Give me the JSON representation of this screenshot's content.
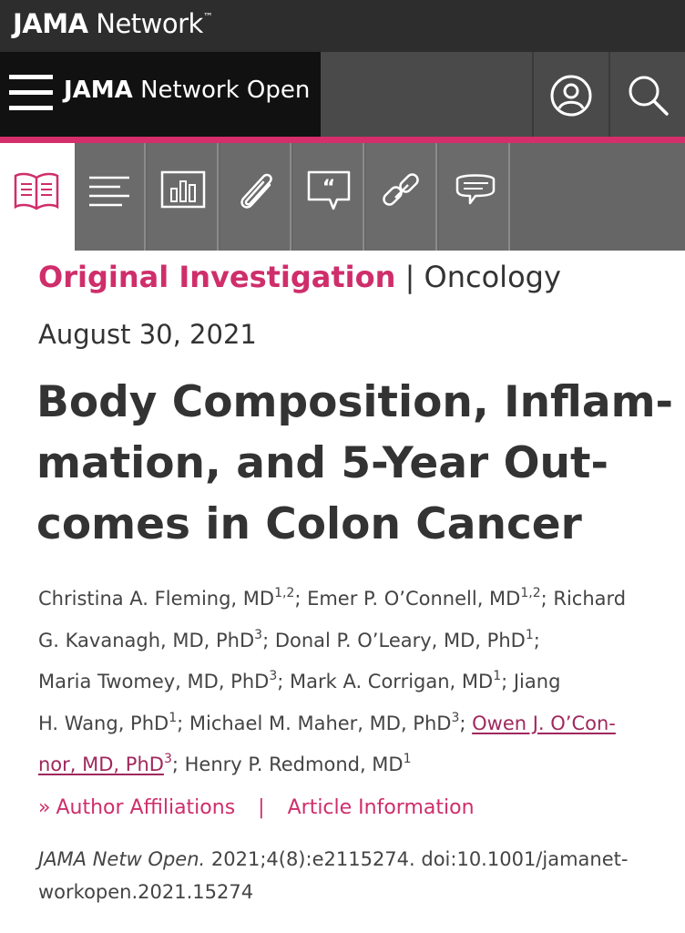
{
  "network": {
    "bold": "JAMA",
    "light": "Network",
    "tm": "™"
  },
  "journal": {
    "bold": "JAMA",
    "light": "Network Open"
  },
  "tabs": [
    {
      "icon": "article-book-icon",
      "active": true
    },
    {
      "icon": "outline-list-icon",
      "active": false
    },
    {
      "icon": "figures-chart-icon",
      "active": false
    },
    {
      "icon": "supplement-paperclip-icon",
      "active": false
    },
    {
      "icon": "comments-quote-icon",
      "active": false
    },
    {
      "icon": "related-link-icon",
      "active": false
    },
    {
      "icon": "discussion-chat-icon",
      "active": false
    }
  ],
  "article": {
    "type": "Original Investigation",
    "separator": "|",
    "subject": "Oncology",
    "date": "August 30, 2021",
    "title_lines": [
      "Body Composition, Inflam-",
      "mation, and 5-Year Out-",
      "comes in Colon Cancer"
    ],
    "authors": {
      "a1": "Christina A. Fleming, MD",
      "a1_sup": "1,2",
      "a2": "; Emer P. O’Connell, MD",
      "a2_sup": "1,2",
      "a3a": "; Richard",
      "a3b": "G. Kavanagh, MD, PhD",
      "a3_sup": "3",
      "a4": "; Donal P. O’Leary, MD, PhD",
      "a4_sup": "1",
      "a4_end": ";",
      "a5": "Maria Twomey, MD, PhD",
      "a5_sup": "3",
      "a6": "; Mark A. Corrigan, MD",
      "a6_sup": "1",
      "a7a": "; Jiang",
      "a7b": "H. Wang, PhD",
      "a7_sup": "1",
      "a8": "; Michael M. Maher, MD, PhD",
      "a8_sup": "3",
      "a8_end": "; ",
      "a9a": "Owen J. O’Con-",
      "a9b": "nor, MD, PhD",
      "a9_sup": "3",
      "a10": "; Henry P. Redmond, MD",
      "a10_sup": "1"
    },
    "links": {
      "chevron": "»",
      "affiliations": "Author Affiliations",
      "divider": "|",
      "info": "Article Information"
    },
    "citation": {
      "journal": "JAMA Netw Open.",
      "line1_rest": " 2021;4(8):e2115274. doi:10.1001/jamanet-",
      "line2": "workopen.2021.15274"
    }
  },
  "colors": {
    "accent": "#d42f6a",
    "link": "#a0285d",
    "topbar": "#2d2d2d",
    "journalbar": "#111111",
    "tabbar": "#6b6b6b"
  }
}
